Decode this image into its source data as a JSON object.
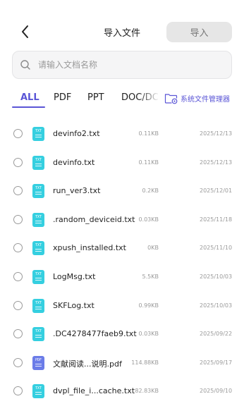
{
  "header": {
    "title": "导入文件",
    "import_label": "导入"
  },
  "search": {
    "placeholder": "请输入文档名称"
  },
  "tabs": [
    {
      "label": "ALL",
      "active": true
    },
    {
      "label": "PDF",
      "active": false
    },
    {
      "label": "PPT",
      "active": false
    },
    {
      "label": "DOC/DC",
      "active": false
    }
  ],
  "file_manager": {
    "label": "系统文件管理器"
  },
  "colors": {
    "accent": "#5a55d6",
    "txt_icon": "#35cfe0",
    "pdf_icon": "#6b7ce8"
  },
  "files": [
    {
      "name": "devinfo2.txt",
      "size": "0.11KB",
      "date": "2025/12/13",
      "type": "TXT"
    },
    {
      "name": "devinfo.txt",
      "size": "0.11KB",
      "date": "2025/12/13",
      "type": "TXT"
    },
    {
      "name": "run_ver3.txt",
      "size": "0.2KB",
      "date": "2025/12/01",
      "type": "TXT"
    },
    {
      "name": ".random_deviceid.txt",
      "size": "0.03KB",
      "date": "2025/11/18",
      "type": "TXT"
    },
    {
      "name": "xpush_installed.txt",
      "size": "0KB",
      "date": "2025/11/10",
      "type": "TXT"
    },
    {
      "name": "LogMsg.txt",
      "size": "5.5KB",
      "date": "2025/10/03",
      "type": "TXT"
    },
    {
      "name": "SKFLog.txt",
      "size": "0.99KB",
      "date": "2025/10/03",
      "type": "TXT"
    },
    {
      "name": ".DC4278477faeb9.txt",
      "size": "0.03KB",
      "date": "2025/09/22",
      "type": "TXT"
    },
    {
      "name": "文献阅读...说明.pdf",
      "size": "114.88KB",
      "date": "2025/09/17",
      "type": "PDF"
    },
    {
      "name": "dvpl_file_i...cache.txt",
      "size": "82.83KB",
      "date": "2025/09/10",
      "type": "TXT"
    }
  ]
}
